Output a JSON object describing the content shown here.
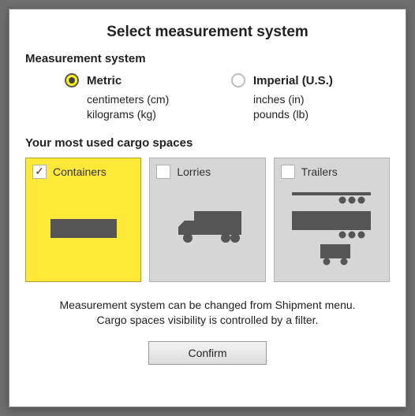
{
  "title": "Select measurement system",
  "measurement": {
    "section_label": "Measurement system",
    "options": [
      {
        "id": "metric",
        "label": "Metric",
        "sub1": "centimeters (cm)",
        "sub2": "kilograms (kg)",
        "selected": true
      },
      {
        "id": "imperial",
        "label": "Imperial (U.S.)",
        "sub1": "inches (in)",
        "sub2": "pounds (lb)",
        "selected": false
      }
    ]
  },
  "cargo": {
    "section_label": "Your most used cargo spaces",
    "items": [
      {
        "id": "containers",
        "label": "Containers",
        "checked": true,
        "icon": "container-icon"
      },
      {
        "id": "lorries",
        "label": "Lorries",
        "checked": false,
        "icon": "lorry-icon"
      },
      {
        "id": "trailers",
        "label": "Trailers",
        "checked": false,
        "icon": "trailer-icon"
      }
    ]
  },
  "note_line1": "Measurement system can be changed from Shipment menu.",
  "note_line2": "Cargo spaces visibility is controlled by a filter.",
  "confirm_label": "Confirm"
}
